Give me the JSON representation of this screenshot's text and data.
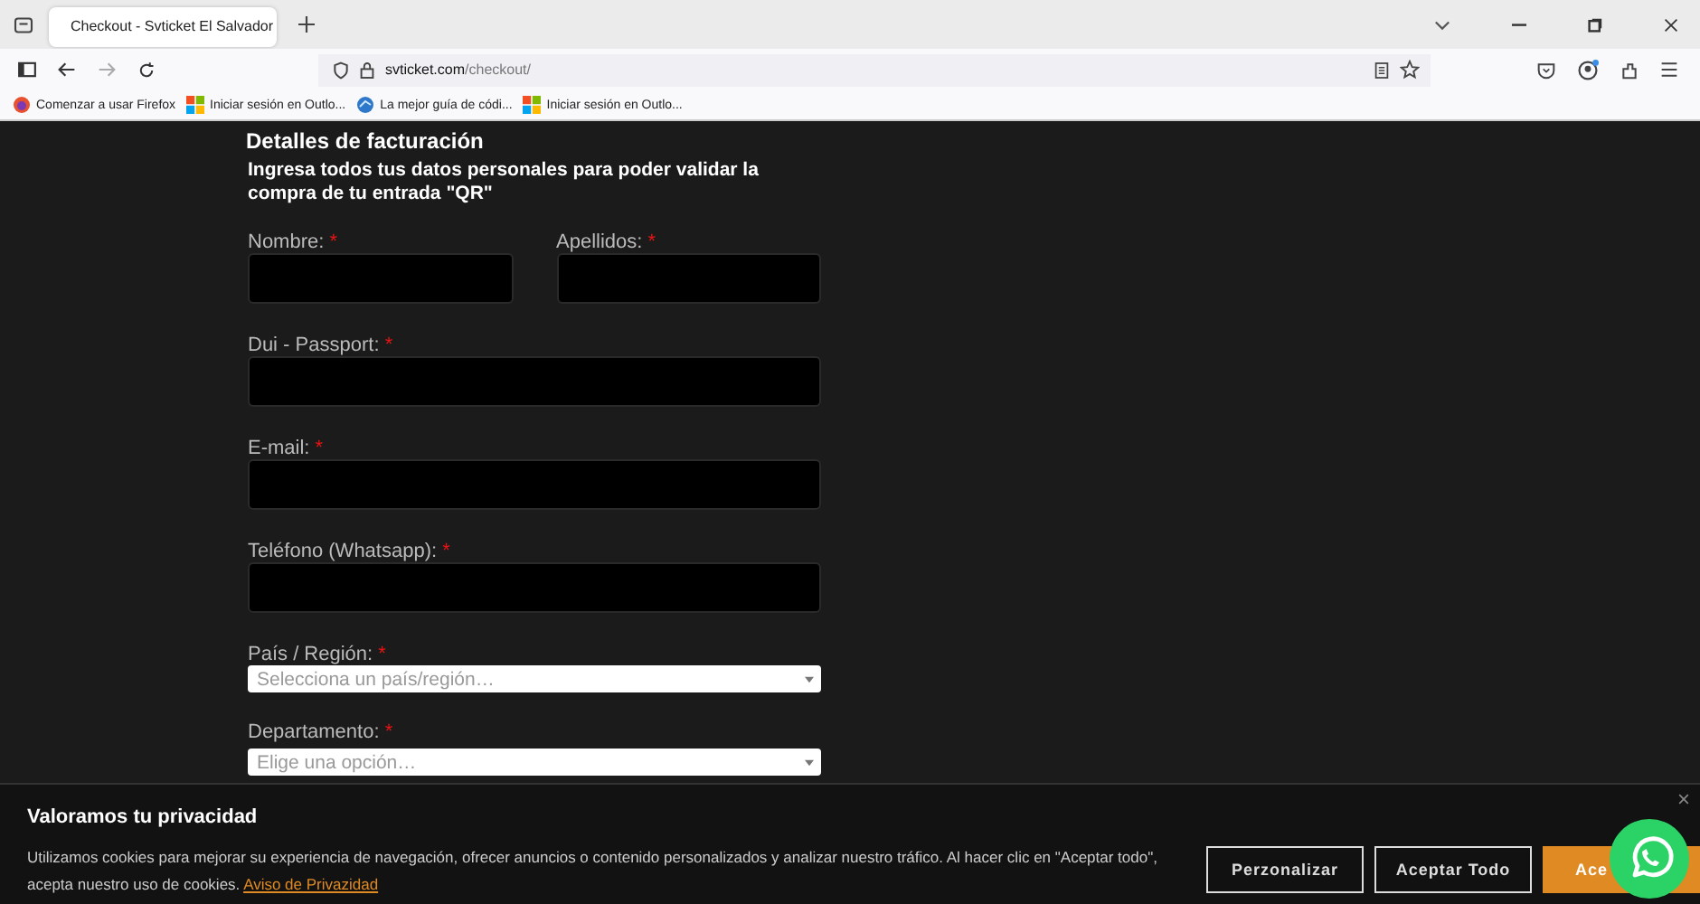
{
  "browser": {
    "tab": {
      "title": "Checkout - Svticket El Salvador",
      "selected": true
    },
    "url_host": "svticket.com",
    "url_path": "/checkout/",
    "bookmarks": [
      {
        "label": "Comenzar a usar Firefox",
        "kind": "firefox"
      },
      {
        "label": "Iniciar sesión en Outlo...",
        "kind": "windows"
      },
      {
        "label": "La mejor guía de códi...",
        "kind": "globe"
      },
      {
        "label": "Iniciar sesión en Outlo...",
        "kind": "windows"
      }
    ]
  },
  "form": {
    "title": "Detalles de facturación",
    "subtitle": "Ingresa todos tus datos personales para poder validar la compra de tu entrada \"QR\"",
    "rows": [
      [
        {
          "label": "Nombre:",
          "mark": "*",
          "kind": "text"
        },
        {
          "label": "Apellidos:",
          "mark": "*",
          "kind": "text"
        }
      ],
      [
        {
          "label": "Dui - Passport:",
          "mark": "*",
          "kind": "text"
        }
      ],
      [
        {
          "label": "E-mail:",
          "mark": "*",
          "kind": "text"
        }
      ],
      [
        {
          "label": "Teléfono (Whatsapp):",
          "mark": "*",
          "kind": "text"
        }
      ],
      [
        {
          "label": "País / Región:",
          "mark": "*",
          "kind": "select",
          "placeholder": "Selecciona un país/región…"
        }
      ],
      [
        {
          "label": "Departamento:",
          "mark": "*",
          "kind": "select",
          "placeholder": "Elige una opción…"
        }
      ]
    ]
  },
  "cookie_banner": {
    "title": "Valoramos tu privacidad",
    "text": "Utilizamos cookies para mejorar su experiencia de navegación, ofrecer anuncios o contenido personalizados y analizar nuestro tráfico. Al hacer clic en \"Aceptar todo\", acepta nuestro uso de cookies.",
    "link": "Aviso de Privazidad",
    "buttons": [
      {
        "label": "Perzonalizar",
        "kind": "outline"
      },
      {
        "label": "Aceptar Todo",
        "kind": "outline"
      },
      {
        "label": "Ace",
        "kind": "filled"
      }
    ]
  }
}
